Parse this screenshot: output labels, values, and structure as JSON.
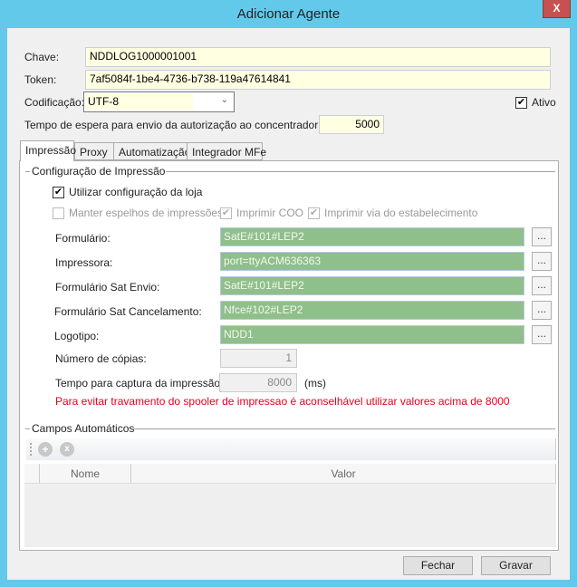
{
  "window": {
    "title": "Adicionar Agente",
    "close_label": "X"
  },
  "form": {
    "chave_label": "Chave:",
    "chave_value": "NDDLOG1000001001",
    "token_label": "Token:",
    "token_value": "7af5084f-1be4-4736-b738-119a47614841",
    "codificacao_label": "Codificação:",
    "codificacao_value": "UTF-8",
    "ativo_label": "Ativo",
    "ativo_checked": true,
    "tempo_label": "Tempo de espera para envio da autorização ao concentrador (ms):",
    "tempo_value": "5000"
  },
  "tabs": [
    {
      "label": "Impressão",
      "selected": true
    },
    {
      "label": "Proxy"
    },
    {
      "label": "Automatização"
    },
    {
      "label": "Integrador MFe"
    }
  ],
  "impressao": {
    "group_title": "Configuração de Impressão",
    "utilizar_label": "Utilizar configuração da loja",
    "utilizar_checked": true,
    "manter_label": "Manter espelhos de impressões",
    "manter_checked": false,
    "coo_label": "Imprimir COO",
    "coo_checked": true,
    "via_label": "Imprimir via do estabelecimento",
    "via_checked": true,
    "fields": [
      {
        "label": "Formulário:",
        "value": "SatE#101#LEP2"
      },
      {
        "label": "Impressora:",
        "value": "port=ttyACM636363"
      },
      {
        "label": "Formulário Sat Envio:",
        "value": "SatE#101#LEP2"
      },
      {
        "label": "Formulário Sat Cancelamento:",
        "value": "Nfce#102#LEP2"
      },
      {
        "label": "Logotipo:",
        "value": "NDD1"
      }
    ],
    "browse_label": "...",
    "copias_label": "Número de cópias:",
    "copias_value": "1",
    "captura_label": "Tempo para captura da impressão:",
    "captura_value": "8000",
    "captura_unit": "(ms)",
    "warning": "Para evitar travamento do spooler de impressao é aconselhável utilizar valores acima de 8000",
    "warning_color": "#e8001c"
  },
  "campos": {
    "group_title": "Campos Automáticos",
    "columns": [
      "Nome",
      "Valor"
    ],
    "rows": []
  },
  "buttons": {
    "fechar": "Fechar",
    "gravar": "Gravar"
  }
}
